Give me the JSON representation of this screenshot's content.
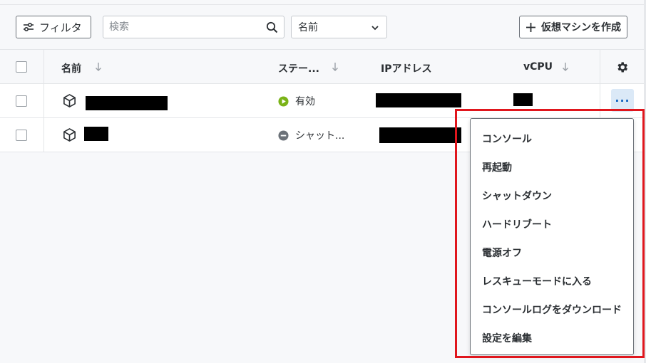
{
  "toolbar": {
    "filter_label": "フィルタ",
    "search_placeholder": "検索",
    "sort_select_value": "名前",
    "create_button_label": "仮想マシンを作成"
  },
  "table": {
    "columns": [
      "名前",
      "ステー...",
      "IPアドレス",
      "vCPU"
    ],
    "rows": [
      {
        "status": "有効",
        "status_color": "#7ab317"
      },
      {
        "status": "シャット...",
        "status_color": "#6b7178"
      }
    ]
  },
  "context_menu": {
    "items": [
      "コンソール",
      "再起動",
      "シャットダウン",
      "ハードリブート",
      "電源オフ",
      "レスキューモードに入る",
      "コンソールログをダウンロード",
      "設定を編集"
    ]
  },
  "icons": {
    "filter": "sliders-icon",
    "search": "search-icon",
    "chevron": "chevron-down-icon",
    "plus": "plus-icon",
    "sort": "arrow-down-icon",
    "settings": "gear-icon",
    "vm": "cube-icon",
    "more": "ellipsis-icon"
  },
  "colors": {
    "accent": "#1565c0",
    "highlight_border": "#e0161d"
  }
}
